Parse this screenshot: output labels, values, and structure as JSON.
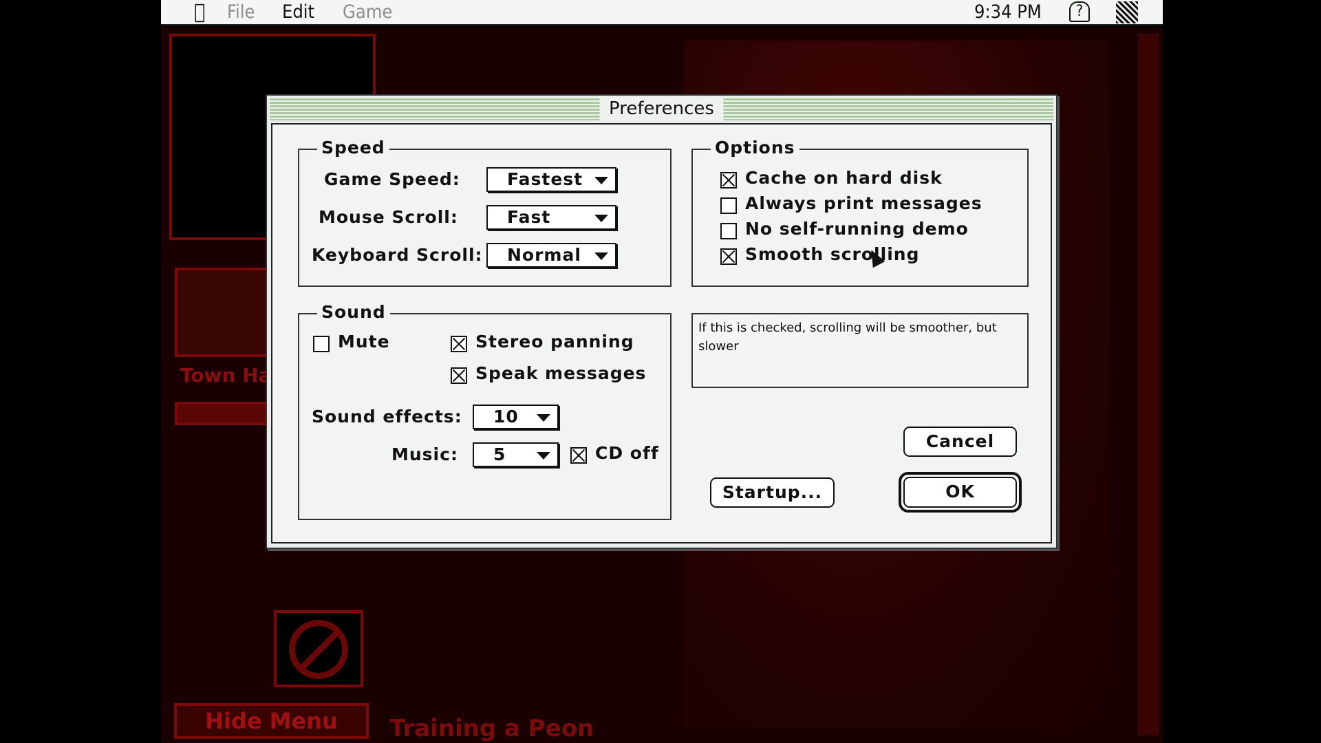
{
  "menubar": {
    "apple_icon": "apple-icon",
    "items": [
      {
        "label": "File",
        "enabled": false
      },
      {
        "label": "Edit",
        "enabled": true
      },
      {
        "label": "Game",
        "enabled": false
      }
    ],
    "clock": "9:34 PM",
    "help_icon": "balloon-help-icon",
    "app_icon": "application-menu-icon"
  },
  "game": {
    "building_label": "Town Ha",
    "hide_menu_label": "Hide Menu",
    "status_text": "Training a Peon",
    "cancel_icon": "prohibited-icon"
  },
  "dialog": {
    "title": "Preferences",
    "speed": {
      "legend": "Speed",
      "game_speed_label": "Game Speed:",
      "game_speed_value": "Fastest",
      "mouse_scroll_label": "Mouse Scroll:",
      "mouse_scroll_value": "Fast",
      "keyboard_scroll_label": "Keyboard Scroll:",
      "keyboard_scroll_value": "Normal"
    },
    "options": {
      "legend": "Options",
      "items": [
        {
          "label": "Cache on hard disk",
          "checked": true
        },
        {
          "label": "Always print messages",
          "checked": false
        },
        {
          "label": "No self-running demo",
          "checked": false
        },
        {
          "label": "Smooth scrolling",
          "checked": true
        }
      ]
    },
    "help_text": "If this is checked, scrolling will be smoother, but slower",
    "sound": {
      "legend": "Sound",
      "mute": {
        "label": "Mute",
        "checked": false
      },
      "stereo": {
        "label": "Stereo panning",
        "checked": true
      },
      "speak": {
        "label": "Speak messages",
        "checked": true
      },
      "effects_label": "Sound effects:",
      "effects_value": "10",
      "music_label": "Music:",
      "music_value": "5",
      "cd_off": {
        "label": "CD off",
        "checked": true
      }
    },
    "buttons": {
      "cancel": "Cancel",
      "ok": "OK",
      "startup": "Startup..."
    }
  }
}
